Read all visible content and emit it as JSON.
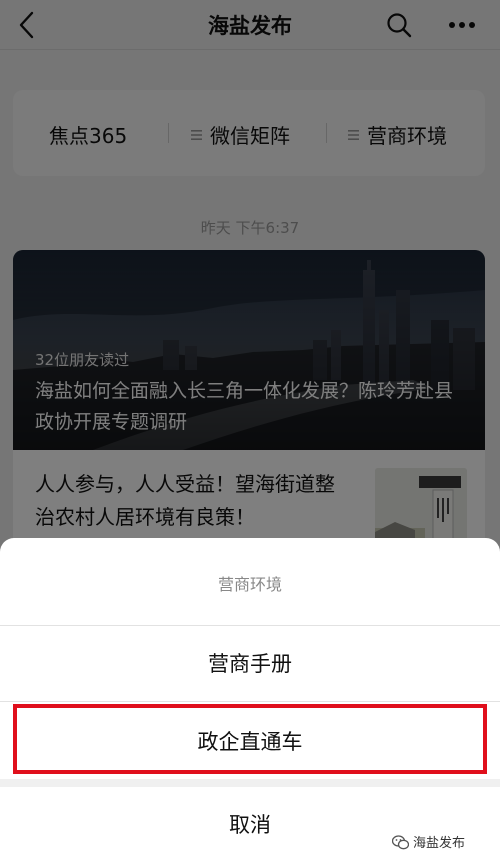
{
  "nav": {
    "title": "海盐发布",
    "back_icon": "back-chevron-icon",
    "search_icon": "search-icon",
    "more_icon": "more-dots-icon"
  },
  "menu": {
    "items": [
      {
        "label": "焦点365",
        "icon": ""
      },
      {
        "label": "微信矩阵",
        "icon": "hamburger-icon"
      },
      {
        "label": "营商环境",
        "icon": "hamburger-icon"
      }
    ]
  },
  "feed": {
    "timestamp": "昨天  下午6:37",
    "cover_article": {
      "read_count": "32位朋友读过",
      "title": "海盐如何全面融入长三角一体化发展？陈玲芳赴县政协开展专题调研"
    },
    "second_article": {
      "title": "人人参与，人人受益！望海街道整治农村人居环境有良策！"
    }
  },
  "action_sheet": {
    "header": "营商环境",
    "options": [
      "营商手册",
      "政企直通车"
    ],
    "cancel": "取消",
    "highlight_color": "#e00f1c"
  },
  "watermark": {
    "text": "海盐发布",
    "icon": "wechat-official-account-icon"
  }
}
